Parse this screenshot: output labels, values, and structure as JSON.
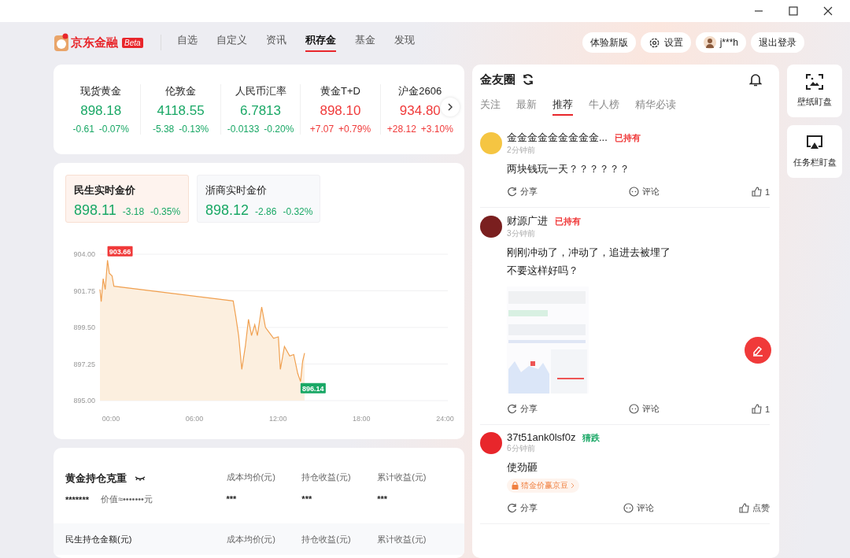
{
  "header": {
    "logo": "京东金融",
    "logo_badge": "Beta",
    "nav": [
      {
        "label": "自选",
        "selected": false
      },
      {
        "label": "自定义",
        "selected": false
      },
      {
        "label": "资讯",
        "selected": false
      },
      {
        "label": "积存金",
        "selected": true
      },
      {
        "label": "基金",
        "selected": false
      },
      {
        "label": "发现",
        "selected": false
      }
    ],
    "actions": [
      {
        "kind": "button",
        "label": "体验新版"
      },
      {
        "kind": "settings",
        "label": "设置"
      },
      {
        "kind": "user",
        "label": "j***h"
      },
      {
        "kind": "button",
        "label": "退出登录"
      }
    ]
  },
  "tickers": [
    {
      "name": "现货黄金",
      "price": "898.18",
      "change": "-0.61",
      "percent": "-0.07%",
      "color": "#1aa866"
    },
    {
      "name": "伦敦金",
      "price": "4118.55",
      "change": "-5.38",
      "percent": "-0.13%",
      "color": "#1aa866"
    },
    {
      "name": "人民币汇率",
      "price": "6.7813",
      "change": "-0.0133",
      "percent": "-0.20%",
      "color": "#1aa866"
    },
    {
      "name": "黄金T+D",
      "price": "898.10",
      "change": "+7.07",
      "percent": "+0.79%",
      "color": "#f03a3a"
    },
    {
      "name": "沪金2606",
      "price": "934.80",
      "change": "+28.12",
      "percent": "+3.10%",
      "color": "#f03a3a"
    }
  ],
  "price_tabs": [
    {
      "title": "民生实时金价",
      "price": "898.11",
      "change": "-3.18",
      "percent": "-0.35%",
      "selected": true
    },
    {
      "title": "浙商实时金价",
      "price": "898.12",
      "change": "-2.86",
      "percent": "-0.32%",
      "selected": false
    }
  ],
  "chart_data": {
    "type": "area",
    "x": [
      -0.79,
      -0.7,
      -0.56,
      -0.41,
      -0.25,
      -0.12,
      0.08,
      0.21,
      8.78,
      8.97,
      9.17,
      9.4,
      9.65,
      9.88,
      10.1,
      10.33,
      10.52,
      10.83,
      11.1,
      11.39,
      11.68,
      12.03,
      12.17,
      12.46,
      12.84,
      13.13,
      13.42,
      13.62,
      13.77,
      13.91
    ],
    "series": [
      {
        "color": "#f0a050",
        "values": [
          901.83,
          901.08,
          902.5,
          901.83,
          903.63,
          902.83,
          902.67,
          902.03,
          901.13,
          900.17,
          899.0,
          896.92,
          898.33,
          900.0,
          899.0,
          899.67,
          899.0,
          900.75,
          899.5,
          899.17,
          898.83,
          898.92,
          896.92,
          898.33,
          897.75,
          897.83,
          896.67,
          896.17,
          897.42,
          897.92
        ]
      }
    ],
    "xlim": [
      -0.79,
      24.2
    ],
    "ylim": [
      895,
      904
    ],
    "xticks": [
      {
        "value": 0,
        "label": "00:00"
      },
      {
        "value": 6,
        "label": "06:00"
      },
      {
        "value": 12,
        "label": "12:00"
      },
      {
        "value": 18,
        "label": "18:00"
      },
      {
        "value": 24,
        "label": "24:00"
      }
    ],
    "yticks": [
      {
        "value": 904,
        "label": "904.00"
      },
      {
        "value": 901.75,
        "label": "901.75"
      },
      {
        "value": 899.5,
        "label": "899.50"
      },
      {
        "value": 897.25,
        "label": "897.25"
      },
      {
        "value": 895,
        "label": "895.00"
      }
    ],
    "grid": true,
    "annotations": [
      {
        "text": "903.66"
      },
      {
        "text": "896.14"
      }
    ]
  },
  "holdings": {
    "title": "黄金持仓克重",
    "amount": "*******",
    "value": "价值≈•••••••元",
    "columns": [
      {
        "label": "成本均价(元)",
        "value": "***"
      },
      {
        "label": "持仓收益(元)",
        "value": "***"
      },
      {
        "label": "累计收益(元)",
        "value": "***"
      }
    ],
    "bank_title": "民生持仓金额(元)",
    "bank_columns": [
      "成本均价(元)",
      "持仓收益(元)",
      "累计收益(元)"
    ]
  },
  "feed": {
    "title": "金友圈",
    "tabs": [
      {
        "label": "关注",
        "selected": false
      },
      {
        "label": "最新",
        "selected": false
      },
      {
        "label": "推荐",
        "selected": true
      },
      {
        "label": "牛人榜",
        "selected": false
      },
      {
        "label": "精华必读",
        "selected": false
      }
    ],
    "posts": [
      {
        "name": "金金金金金金金金金...",
        "tag": "已持有",
        "color": "#f03a3a",
        "time": "2分钟前",
        "lines": [
          "两块钱玩一天？？？？？？"
        ],
        "share": "分享",
        "comment": "评论",
        "like": "1"
      },
      {
        "name": "财源广进",
        "tag": "已持有",
        "color": "#f03a3a",
        "time": "3分钟前",
        "lines": [
          "刚刚冲动了，冲动了，追进去被埋了",
          "不要这样好吗？"
        ],
        "image": {
          "kind": "picture"
        },
        "share": "分享",
        "comment": "评论",
        "like": "1"
      },
      {
        "name": "37t51ank0lsf0z",
        "tag": "猜跌",
        "color": "#1aa866",
        "time": "6分钟前",
        "lines": [
          "使劲砸"
        ],
        "promo": "猜金价赢京豆",
        "share": "分享",
        "comment": "评论",
        "like": "点赞"
      }
    ]
  },
  "side_tools": [
    {
      "kind": "wallpaper",
      "label": "壁纸盯盘"
    },
    {
      "kind": "taskbar",
      "label": "任务栏盯盘"
    }
  ]
}
